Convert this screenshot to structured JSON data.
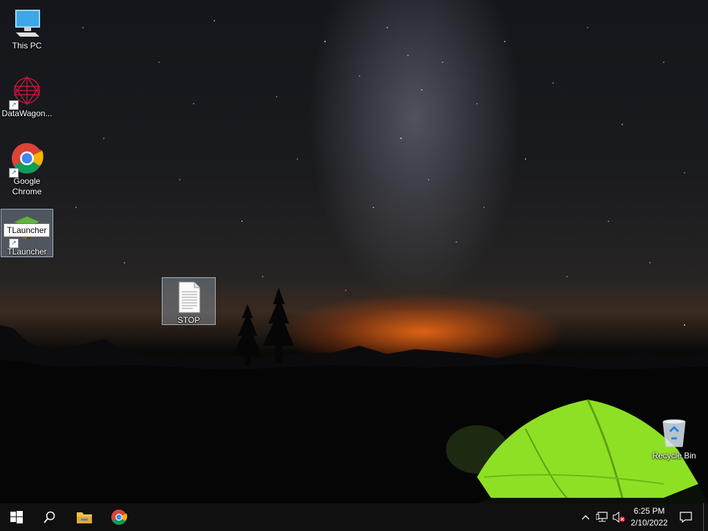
{
  "desktop": {
    "icons": [
      {
        "label": "This PC"
      },
      {
        "label": "DataWagon..."
      },
      {
        "label": "Google Chrome"
      },
      {
        "label": "TLauncher"
      },
      {
        "label": "STOP"
      },
      {
        "label": "Recycle Bin"
      }
    ],
    "tooltip": "TLauncher"
  },
  "taskbar": {
    "start_icon": "windows-logo-icon",
    "search_icon": "search-icon",
    "pinned": [
      "file-explorer-icon",
      "chrome-icon"
    ],
    "tray_icons": [
      "chevron-up-icon",
      "network-icon",
      "volume-muted-icon"
    ],
    "clock": {
      "time": "6:25 PM",
      "date": "2/10/2022"
    },
    "notification_icon": "action-center-icon"
  },
  "colors": {
    "taskbar": "#101010",
    "tent": "#8ee024",
    "accent": "#0078d7"
  }
}
